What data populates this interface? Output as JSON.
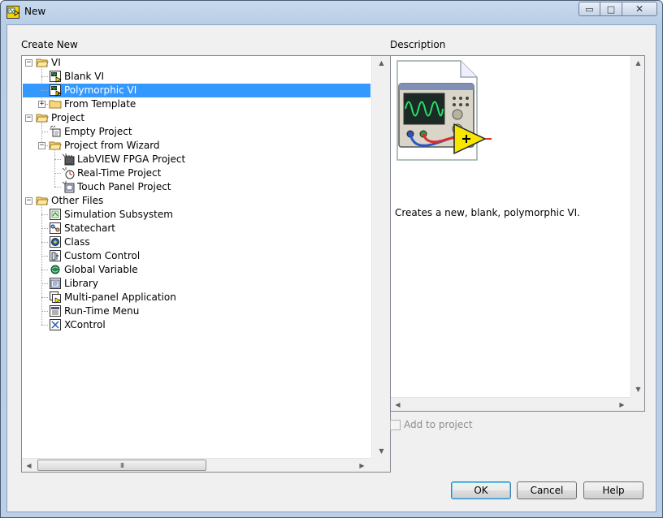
{
  "window": {
    "title": "New",
    "controls": {
      "minimize": "▭",
      "maximize": "□",
      "close": "✕"
    }
  },
  "create_new": {
    "label": "Create New",
    "tree": [
      {
        "label": "VI",
        "icon": "folder-open-icon",
        "level": 0,
        "expander": "−"
      },
      {
        "label": "Blank VI",
        "icon": "vi-icon",
        "level": 1
      },
      {
        "label": "Polymorphic VI",
        "icon": "polymorphic-vi-icon",
        "level": 1,
        "selected": true
      },
      {
        "label": "From Template",
        "icon": "folder-icon",
        "level": 1,
        "expander": "+"
      },
      {
        "label": "Project",
        "icon": "folder-open-icon",
        "level": 0,
        "expander": "−"
      },
      {
        "label": "Empty Project",
        "icon": "project-icon",
        "level": 1
      },
      {
        "label": "Project from Wizard",
        "icon": "folder-open-icon",
        "level": 1,
        "expander": "−"
      },
      {
        "label": "LabVIEW FPGA Project",
        "icon": "fpga-project-icon",
        "level": 2
      },
      {
        "label": "Real-Time Project",
        "icon": "realtime-project-icon",
        "level": 2
      },
      {
        "label": "Touch Panel Project",
        "icon": "touch-panel-project-icon",
        "level": 2
      },
      {
        "label": "Other Files",
        "icon": "folder-open-icon",
        "level": 0,
        "expander": "−"
      },
      {
        "label": "Simulation Subsystem",
        "icon": "simulation-subsystem-icon",
        "level": 1
      },
      {
        "label": "Statechart",
        "icon": "statechart-icon",
        "level": 1
      },
      {
        "label": "Class",
        "icon": "class-icon",
        "level": 1
      },
      {
        "label": "Custom Control",
        "icon": "custom-control-icon",
        "level": 1
      },
      {
        "label": "Global Variable",
        "icon": "global-variable-icon",
        "level": 1
      },
      {
        "label": "Library",
        "icon": "library-icon",
        "level": 1
      },
      {
        "label": "Multi-panel Application",
        "icon": "multi-panel-app-icon",
        "level": 1
      },
      {
        "label": "Run-Time Menu",
        "icon": "runtime-menu-icon",
        "level": 1
      },
      {
        "label": "XControl",
        "icon": "xcontrol-icon",
        "level": 1
      }
    ],
    "scroll_grip": "III"
  },
  "description": {
    "label": "Description",
    "text": "Creates a new, blank, polymorphic VI.",
    "preview_icon": "polymorphic-vi-large-icon"
  },
  "add_to_project": {
    "label": "Add to project",
    "checked": false,
    "enabled": false
  },
  "buttons": {
    "ok": "OK",
    "cancel": "Cancel",
    "help": "Help"
  },
  "colors": {
    "selection": "#3399ff",
    "frame": "#b8cde6"
  }
}
